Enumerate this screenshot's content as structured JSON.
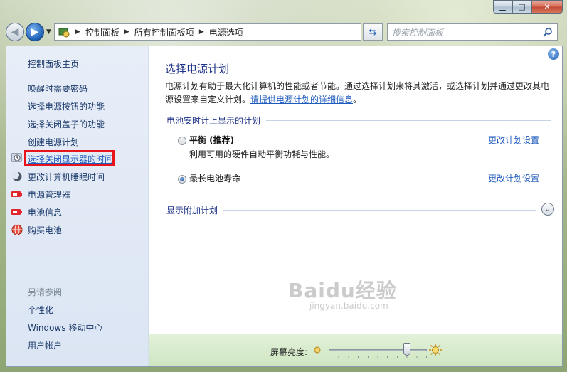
{
  "window": {
    "caption": {
      "minimize": "▁",
      "maximize": "□",
      "close": "✕"
    }
  },
  "address_bar": {
    "breadcrumbs": [
      "控制面板",
      "所有控制面板项",
      "电源选项"
    ],
    "search_placeholder": "搜索控制面板"
  },
  "sidebar": {
    "home": "控制面板主页",
    "links": [
      {
        "label": "唤醒时需要密码",
        "icon": ""
      },
      {
        "label": "选择电源按钮的功能",
        "icon": ""
      },
      {
        "label": "选择关闭盖子的功能",
        "icon": ""
      },
      {
        "label": "创建电源计划",
        "icon": ""
      },
      {
        "label": "选择关闭显示器的时间",
        "icon": "display-clock-icon",
        "highlighted": true
      },
      {
        "label": "更改计算机睡眠时间",
        "icon": "moon-icon"
      },
      {
        "label": "电源管理器",
        "icon": "battery-red-icon"
      },
      {
        "label": "电池信息",
        "icon": "battery-red-icon"
      },
      {
        "label": "购买电池",
        "icon": "globe-icon"
      }
    ],
    "see_also": "另请参阅",
    "see_also_links": [
      "个性化",
      "Windows 移动中心",
      "用户帐户"
    ]
  },
  "main": {
    "title": "选择电源计划",
    "description": "电源计划有助于最大化计算机的性能或者节能。通过选择计划来将其激活，或选择计划并通过更改其电源设置来自定义计划。",
    "description_link": "请提供电源计划的详细信息",
    "description_end": "。",
    "section_title": "电池安时计上显示的计划",
    "plans": [
      {
        "name": "平衡 (推荐)",
        "desc": "利用可用的硬件自动平衡功耗与性能。",
        "link": "更改计划设置",
        "selected": false
      },
      {
        "name": "最长电池寿命",
        "desc": "",
        "link": "更改计划设置",
        "selected": true
      }
    ],
    "extra_section": "显示附加计划",
    "help": "?"
  },
  "bottom": {
    "brightness_label": "屏幕亮度:",
    "brightness_level_percent": 80
  },
  "watermark": {
    "main": "Baidu经验",
    "sub": "jingyan.baidu.com"
  },
  "colors": {
    "highlight_border": "#e8131b",
    "link": "#1f5bbd",
    "title": "#1e3287"
  }
}
